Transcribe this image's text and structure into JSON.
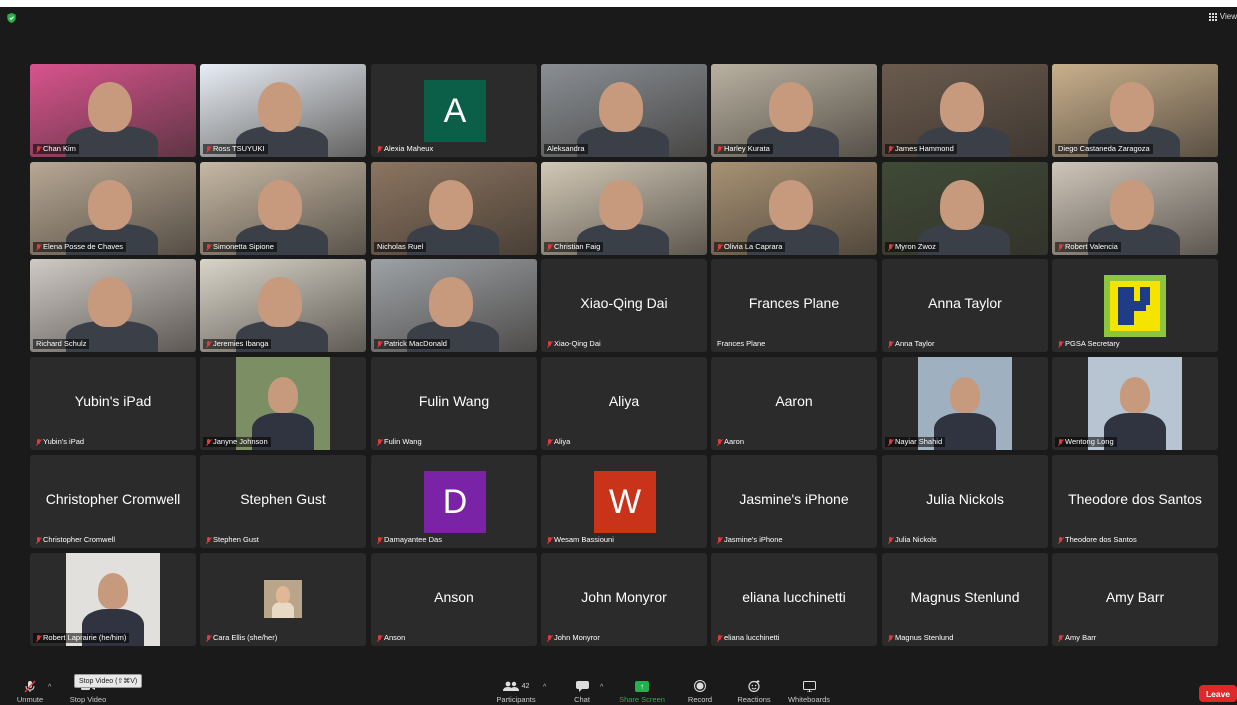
{
  "header": {
    "view_label": "View"
  },
  "participants": [
    {
      "name": "Chan Kim",
      "type": "video",
      "bg": "#d9538e",
      "muted": true
    },
    {
      "name": "Ross TSUYUKI",
      "type": "video",
      "bg": "#e8eef5",
      "muted": true
    },
    {
      "name": "Alexia Maheux",
      "type": "avatar",
      "letter": "A",
      "color": "#0b5e47",
      "muted": true
    },
    {
      "name": "Aleksandra",
      "type": "video",
      "bg": "#8a8f94",
      "muted": false
    },
    {
      "name": "Harley Kurata",
      "type": "video",
      "bg": "#b9b1a1",
      "muted": true
    },
    {
      "name": "James Hammond",
      "type": "video",
      "bg": "#6b5b4e",
      "muted": true
    },
    {
      "name": "Diego Castaneda Zaragoza",
      "type": "video",
      "bg": "#c9b08c",
      "muted": false,
      "active": true
    },
    {
      "name": "Elena Posse de Chaves",
      "type": "video",
      "bg": "#b8a894",
      "muted": true
    },
    {
      "name": "Simonetta Sipione",
      "type": "video",
      "bg": "#c6b8a4",
      "muted": true
    },
    {
      "name": "Nicholas Ruel",
      "type": "video",
      "bg": "#8c7560",
      "muted": false
    },
    {
      "name": "Christian Faig",
      "type": "video",
      "bg": "#d2c8b6",
      "muted": true
    },
    {
      "name": "Olivia La Caprara",
      "type": "video",
      "bg": "#a89274",
      "muted": true
    },
    {
      "name": "Myron Zwoz",
      "type": "video",
      "bg": "#3f4a36",
      "muted": true
    },
    {
      "name": "Robert Valencia",
      "type": "video",
      "bg": "#cfc6ba",
      "muted": true
    },
    {
      "name": "Richard Schulz",
      "type": "video",
      "bg": "#cfcac4",
      "muted": false
    },
    {
      "name": "Jeremies Ibanga",
      "type": "video",
      "bg": "#d8d4c8",
      "muted": true
    },
    {
      "name": "Patrick MacDonald",
      "type": "video",
      "bg": "#9ea2a6",
      "muted": true
    },
    {
      "name": "Xiao-Qing Dai",
      "type": "text",
      "muted": true
    },
    {
      "name": "Frances Plane",
      "type": "text",
      "muted": false
    },
    {
      "name": "Anna Taylor",
      "type": "text",
      "muted": true
    },
    {
      "name": "PGSA Secretary",
      "type": "logo",
      "muted": true
    },
    {
      "name": "Yubin's iPad",
      "type": "text",
      "muted": true
    },
    {
      "name": "Janyne Johnson",
      "type": "photo",
      "bg": "#7c8f64",
      "muted": true
    },
    {
      "name": "Fulin Wang",
      "type": "text",
      "muted": true
    },
    {
      "name": "Aliya",
      "type": "text",
      "muted": true
    },
    {
      "name": "Aaron",
      "type": "text",
      "muted": true
    },
    {
      "name": "Nayiar Shahid",
      "type": "photo",
      "bg": "#9fb0c0",
      "muted": true
    },
    {
      "name": "Wentong Long",
      "type": "photo",
      "bg": "#b7c4d2",
      "muted": true
    },
    {
      "name": "Christopher Cromwell",
      "type": "text",
      "muted": true
    },
    {
      "name": "Stephen Gust",
      "type": "text",
      "muted": true
    },
    {
      "name": "Damayantee Das",
      "type": "avatar",
      "letter": "D",
      "color": "#7b23a6",
      "muted": true
    },
    {
      "name": "Wesam Bassiouni",
      "type": "avatar",
      "letter": "W",
      "color": "#c9331a",
      "muted": true
    },
    {
      "name": "Jasmine's iPhone",
      "type": "text",
      "muted": true
    },
    {
      "name": "Julia Nickols",
      "type": "text",
      "muted": true
    },
    {
      "name": "Theodore dos Santos",
      "type": "text",
      "muted": true
    },
    {
      "name": "Robert Laprairie (he/him)",
      "type": "photo",
      "bg": "#e2e0dd",
      "muted": true
    },
    {
      "name": "Cara Ellis (she/her)",
      "type": "smallphoto",
      "bg": "#b9a58a",
      "muted": true
    },
    {
      "name": "Anson",
      "type": "text",
      "muted": true
    },
    {
      "name": "John Monyror",
      "type": "text",
      "muted": true
    },
    {
      "name": "eliana lucchinetti",
      "type": "text",
      "muted": true
    },
    {
      "name": "Magnus Stenlund",
      "type": "text",
      "muted": true
    },
    {
      "name": "Amy Barr",
      "type": "text",
      "muted": true
    }
  ],
  "toolbar": {
    "unmute": "Unmute",
    "stop_video": "Stop Video",
    "participants": "Participants",
    "participants_count": "42",
    "chat": "Chat",
    "share_screen": "Share Screen",
    "record": "Record",
    "reactions": "Reactions",
    "whiteboards": "Whiteboards",
    "leave": "Leave",
    "tooltip": "Stop Video (⇧⌘V)"
  },
  "colors": {
    "share_green": "#23b14d",
    "leave_red": "#e02828",
    "active_outline": "#5bd15b"
  }
}
